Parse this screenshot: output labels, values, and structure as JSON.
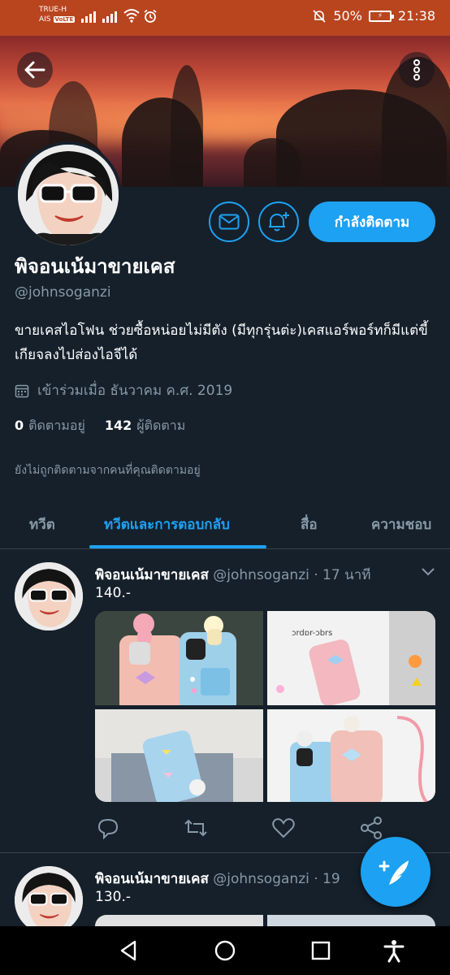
{
  "status_bar": {
    "carrier_line1": "TRUE-H",
    "carrier_line2": "AIS",
    "volte": "VoLTE",
    "battery": "50%",
    "time": "21:38"
  },
  "header": {
    "back_icon": "arrow-left-icon",
    "more_icon": "more-vertical-icon"
  },
  "profile": {
    "name": "พิจอนเน้มาขายเคส",
    "handle": "@johnsoganzi",
    "bio": "ขายเคสไอโฟน ช่วยซื้อหน่อยไม่มีตัง (มีทุกรุ่นต่ะ)เคสแอร์พอร์ทก็มีแต่ขี้เกียจลงไปส่องไอจีได้",
    "joined": "เข้าร่วมเมื่อ ธันวาคม ค.ศ. 2019",
    "following_count": "0",
    "following_label": "ติดตามอยู่",
    "followers_count": "142",
    "followers_label": "ผู้ติดตาม",
    "not_followed_text": "ยังไม่ถูกติดตามจากคนที่คุณติดตามอยู่",
    "follow_button": "กำลังติดตาม"
  },
  "tabs": [
    {
      "label": "ทวีต",
      "active": false
    },
    {
      "label": "ทวีตและการตอบกลับ",
      "active": true
    },
    {
      "label": "สื่อ",
      "active": false
    },
    {
      "label": "ความชอบ",
      "active": false
    }
  ],
  "tweets": [
    {
      "name": "พิจอนเน้มาขายเคส",
      "handle_time": "@johnsoganzi · 17 นาที",
      "text": "140.-"
    },
    {
      "name": "พิจอนเน้มาขายเคส",
      "handle_time": "@johnsoganzi · 19",
      "text": "130.-"
    }
  ],
  "colors": {
    "background": "#15202b",
    "accent": "#1da1f2",
    "secondary_text": "#8899a6",
    "status_bar": "#b9451f"
  }
}
